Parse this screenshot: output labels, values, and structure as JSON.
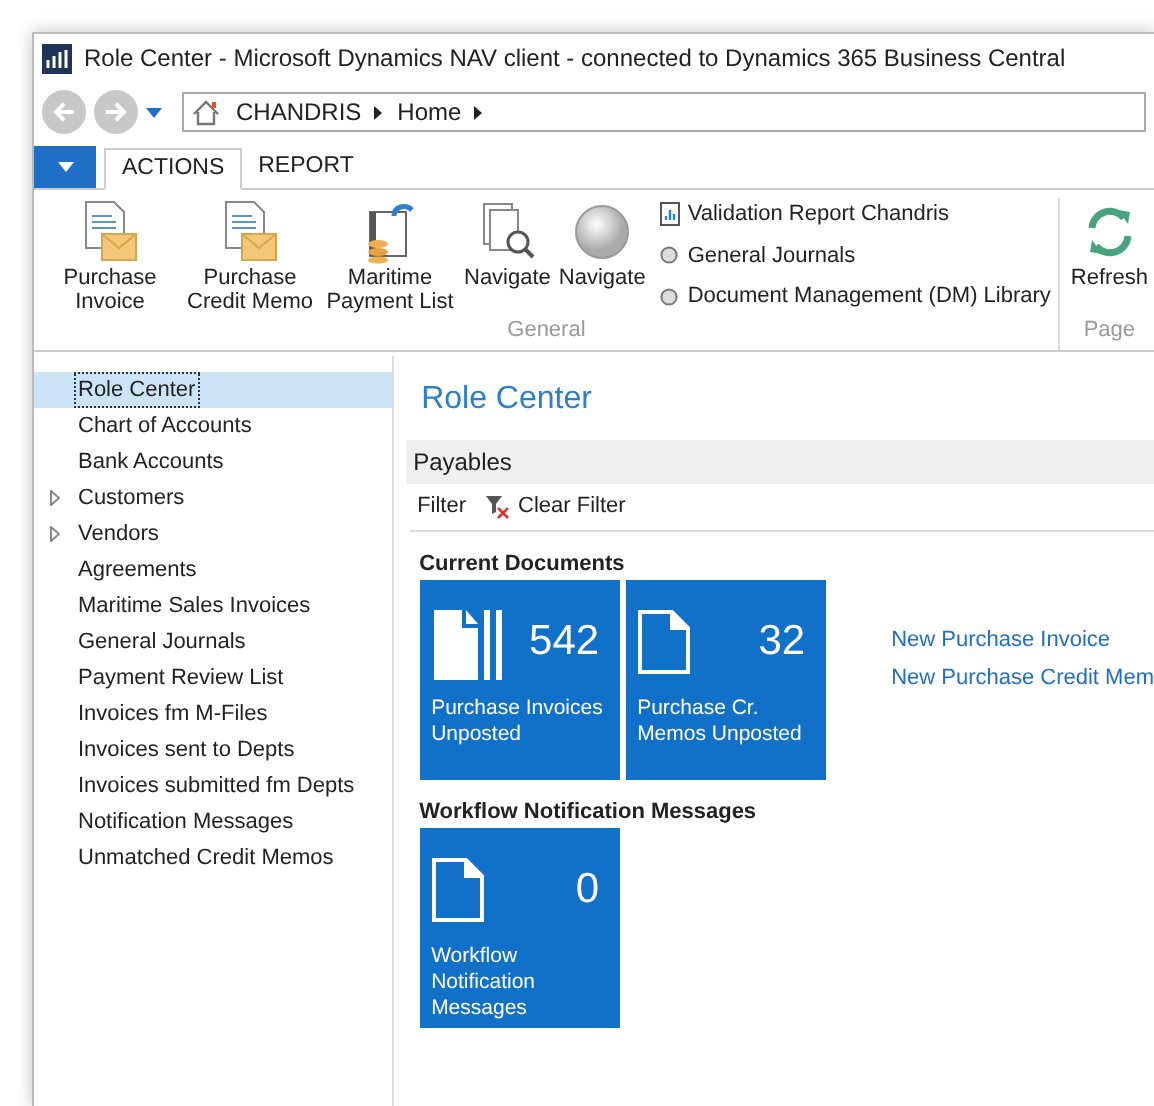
{
  "window": {
    "title": "Role Center - Microsoft Dynamics NAV client - connected to Dynamics 365 Business Central"
  },
  "breadcrumb": [
    "CHANDRIS",
    "Home"
  ],
  "ribbon_tabs": [
    {
      "label": "ACTIONS",
      "selected": true
    },
    {
      "label": "REPORT",
      "selected": false
    }
  ],
  "ribbon": {
    "groups": [
      {
        "label": "General",
        "items": [
          {
            "kind": "invoice",
            "label": "Purchase Invoice"
          },
          {
            "kind": "invoice",
            "label": "Purchase Credit Memo"
          },
          {
            "kind": "payment",
            "label": "Maritime Payment List"
          },
          {
            "kind": "pages",
            "label": "Navigate"
          },
          {
            "kind": "circle",
            "label": "Navigate"
          }
        ],
        "small_items": [
          {
            "kind": "report",
            "label": "Validation Report Chandris"
          },
          {
            "kind": "dot",
            "label": "General Journals"
          },
          {
            "kind": "dot",
            "label": "Document Management (DM) Library"
          }
        ]
      },
      {
        "label": "Page",
        "items": [
          {
            "kind": "refresh",
            "label": "Refresh"
          }
        ]
      }
    ]
  },
  "sidebar": {
    "items": [
      {
        "label": "Role Center",
        "selected": true,
        "expandable": false
      },
      {
        "label": "Chart of Accounts",
        "selected": false,
        "expandable": false
      },
      {
        "label": "Bank Accounts",
        "selected": false,
        "expandable": false
      },
      {
        "label": "Customers",
        "selected": false,
        "expandable": true
      },
      {
        "label": "Vendors",
        "selected": false,
        "expandable": true
      },
      {
        "label": "Agreements",
        "selected": false,
        "expandable": false
      },
      {
        "label": "Maritime Sales Invoices",
        "selected": false,
        "expandable": false
      },
      {
        "label": "General Journals",
        "selected": false,
        "expandable": false
      },
      {
        "label": "Payment Review List",
        "selected": false,
        "expandable": false
      },
      {
        "label": "Invoices fm M-Files",
        "selected": false,
        "expandable": false
      },
      {
        "label": "Invoices sent to Depts",
        "selected": false,
        "expandable": false
      },
      {
        "label": "Invoices submitted fm Depts",
        "selected": false,
        "expandable": false
      },
      {
        "label": "Notification Messages",
        "selected": false,
        "expandable": false
      },
      {
        "label": "Unmatched Credit Memos",
        "selected": false,
        "expandable": false
      }
    ]
  },
  "page": {
    "title": "Role Center",
    "part": "Payables",
    "filter": "Filter",
    "clear_filter": "Clear Filter",
    "sections": [
      {
        "title": "Current Documents",
        "tiles": [
          {
            "kind": "stack",
            "count": "542",
            "label": "Purchase Invoices Unposted"
          },
          {
            "kind": "single",
            "count": "32",
            "label": "Purchase Cr. Memos Unposted"
          }
        ],
        "links": [
          "New Purchase Invoice",
          "New Purchase Credit Mem"
        ]
      },
      {
        "title": "Workflow Notification Messages",
        "tiles": [
          {
            "kind": "single",
            "count": "0",
            "label": "Workflow Notification Messages"
          }
        ]
      }
    ]
  }
}
